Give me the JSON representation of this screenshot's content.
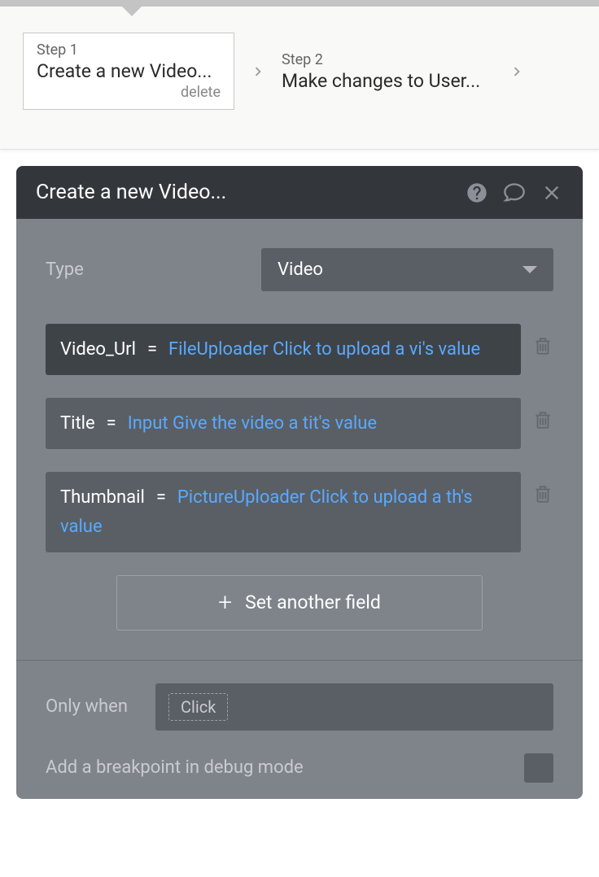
{
  "workflow": {
    "steps": [
      {
        "label": "Step 1",
        "title": "Create a new Video...",
        "delete": "delete"
      },
      {
        "label": "Step 2",
        "title": "Make changes to User..."
      }
    ]
  },
  "editor": {
    "title": "Create a new Video...",
    "type": {
      "label": "Type",
      "value": "Video"
    },
    "fields": [
      {
        "name": "Video_Url",
        "value": "FileUploader Click to upload a vi's value"
      },
      {
        "name": "Title",
        "value": "Input Give the video a tit's value"
      },
      {
        "name": "Thumbnail",
        "value": "PictureUploader Click to upload a th's value"
      }
    ],
    "setFieldButton": "Set another field",
    "onlyWhen": {
      "label": "Only when",
      "chip": "Click"
    },
    "breakpoint": "Add a breakpoint in debug mode"
  }
}
